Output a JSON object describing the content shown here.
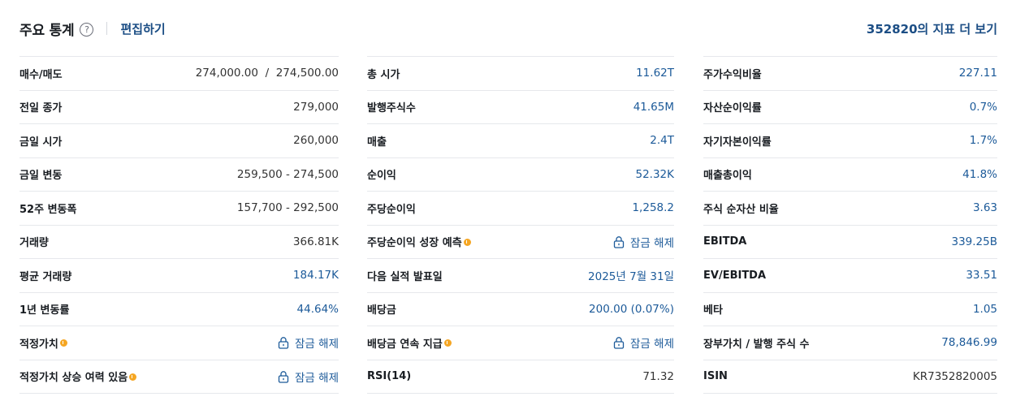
{
  "header": {
    "title": "주요 통계",
    "help_icon": "?",
    "edit_label": "편집하기",
    "more_label": "352820의 지표 더 보기"
  },
  "columns": [
    {
      "rows": [
        {
          "label": "매수/매도",
          "value": "274,000.00  /  274,500.00",
          "style": "plain"
        },
        {
          "label": "전일 종가",
          "value": "279,000",
          "style": "plain"
        },
        {
          "label": "금일 시가",
          "value": "260,000",
          "style": "plain"
        },
        {
          "label": "금일 변동",
          "value": "259,500 - 274,500",
          "style": "plain"
        },
        {
          "label": "52주 변동폭",
          "value": "157,700 - 292,500",
          "style": "plain"
        },
        {
          "label": "거래량",
          "value": "366.81K",
          "style": "plain"
        },
        {
          "label": "평균 거래량",
          "value": "184.17K",
          "style": "link"
        },
        {
          "label": "1년 변동률",
          "value": "44.64%",
          "style": "link"
        },
        {
          "label": "적정가치",
          "value": "잠금 해제",
          "style": "locked",
          "pro": true
        },
        {
          "label": "적정가치 상승 여력 있음",
          "value": "잠금 해제",
          "style": "locked",
          "pro": true
        }
      ]
    },
    {
      "rows": [
        {
          "label": "총 시가",
          "value": "11.62T",
          "style": "link"
        },
        {
          "label": "발행주식수",
          "value": "41.65M",
          "style": "link"
        },
        {
          "label": "매출",
          "value": "2.4T",
          "style": "link"
        },
        {
          "label": "순이익",
          "value": "52.32K",
          "style": "link"
        },
        {
          "label": "주당순이익",
          "value": "1,258.2",
          "style": "link"
        },
        {
          "label": "주당순이익 성장 예측",
          "value": "잠금 해제",
          "style": "locked",
          "pro": true
        },
        {
          "label": "다음 실적 발표일",
          "value": "2025년 7월 31일",
          "style": "link"
        },
        {
          "label": "배당금",
          "value": "200.00 (0.07%)",
          "style": "link"
        },
        {
          "label": "배당금 연속 지급",
          "value": "잠금 해제",
          "style": "locked",
          "pro": true
        },
        {
          "label": "RSI(14)",
          "value": "71.32",
          "style": "plain"
        }
      ]
    },
    {
      "rows": [
        {
          "label": "주가수익비율",
          "value": "227.11",
          "style": "link"
        },
        {
          "label": "자산순이익률",
          "value": "0.7%",
          "style": "link"
        },
        {
          "label": "자기자본이익률",
          "value": "1.7%",
          "style": "link"
        },
        {
          "label": "매출총이익",
          "value": "41.8%",
          "style": "link"
        },
        {
          "label": "주식 순자산 비율",
          "value": "3.63",
          "style": "link"
        },
        {
          "label": "EBITDA",
          "value": "339.25B",
          "style": "link"
        },
        {
          "label": "EV/EBITDA",
          "value": "33.51",
          "style": "link"
        },
        {
          "label": "베타",
          "value": "1.05",
          "style": "link"
        },
        {
          "label": "장부가치 / 발행 주식 수",
          "value": "78,846.99",
          "style": "link"
        },
        {
          "label": "ISIN",
          "value": "KR7352820005",
          "style": "plain"
        }
      ]
    }
  ],
  "icons": {
    "lock": "lock-icon",
    "pro": "pro-badge-icon",
    "help": "help-icon"
  },
  "colors": {
    "link": "#1c5a99",
    "pro_badge": "#f5a623",
    "divider": "#e6e8ec"
  }
}
